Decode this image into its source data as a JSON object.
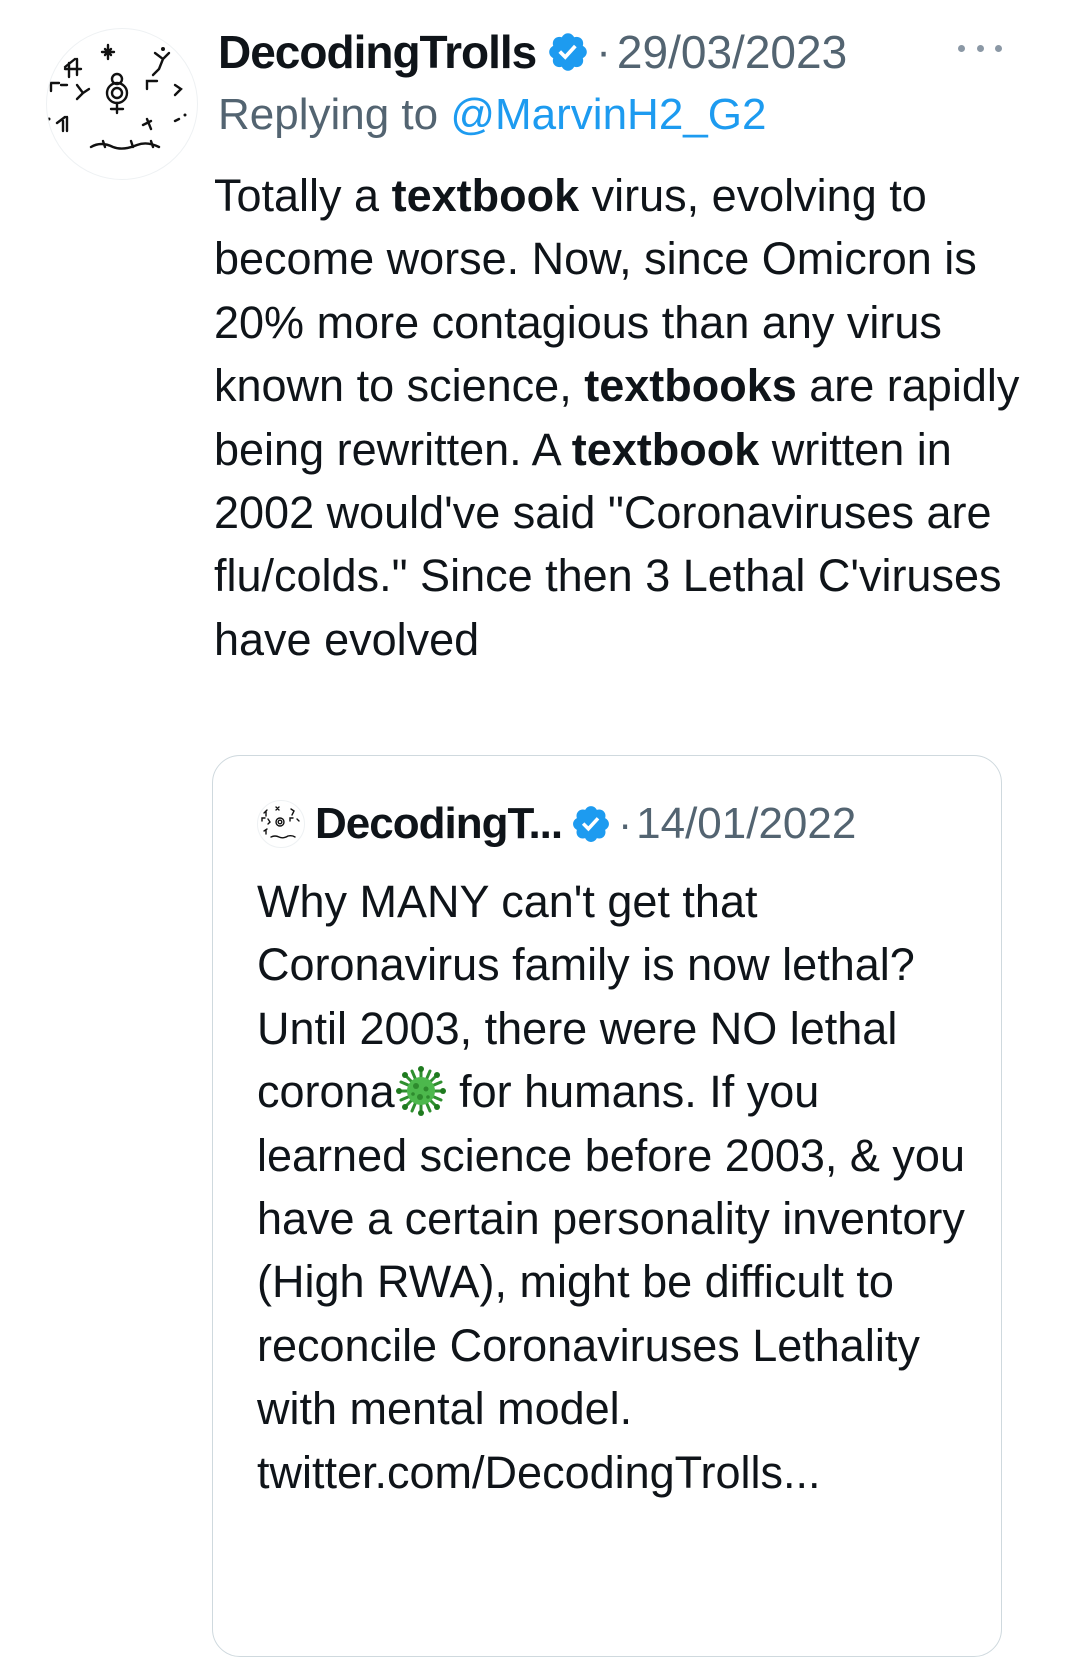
{
  "tweet": {
    "display_name": "DecodingTrolls",
    "date": "29/03/2023",
    "separator": "·",
    "reply_prefix": "Replying to ",
    "reply_to": "@MarvinH2_G2",
    "text_parts": [
      "Totally a ",
      "textbook",
      " virus, evolving to become worse. Now, since Omicron is 20% more contagious than any virus known to science, ",
      "textbooks",
      " are rapidly being rewritten. A ",
      "textbook",
      " written in 2002 would've said \"Coronaviruses are flu/colds.\" Since then 3 Lethal C'viruses have evolved"
    ]
  },
  "quoted_tweet": {
    "display_name": "DecodingT...",
    "separator": "·",
    "date": "14/01/2022",
    "text_before_icon": "Why MANY can't get that Coronavirus family is now lethal? Until 2003, there were NO lethal corona",
    "text_after_icon": " for humans. If you learned science before 2003, & you have a certain personality inventory (High RWA), might be difficult to reconcile Coronaviruses Lethality with mental model. twitter.com/DecodingTrolls..."
  },
  "colors": {
    "text": "#0f1419",
    "secondary": "#536471",
    "link": "#1d9bf0",
    "verified": "#1d9bf0",
    "border": "#cfd9de",
    "virus": "#3aa63a"
  },
  "icons": {
    "verified": "verified-badge-icon",
    "more": "more-horizontal-icon",
    "virus": "microbe-emoji-icon"
  }
}
